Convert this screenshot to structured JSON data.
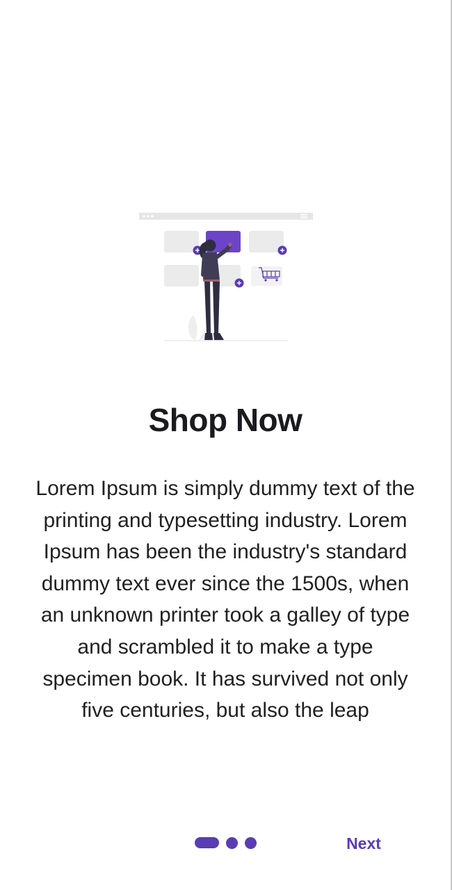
{
  "onboarding": {
    "illustration": "shopping-woman-illustration",
    "title": "Shop Now",
    "description": "Lorem Ipsum is simply dummy text of the printing and typesetting industry. Lorem Ipsum has been the industry's standard dummy text ever since the 1500s, when an unknown printer took a galley of type and scrambled it to make a type specimen book. It has survived not only five centuries, but also the leap",
    "next_label": "Next",
    "page_indicator": {
      "total_pages": 3,
      "current_page": 1
    }
  },
  "colors": {
    "accent": "#5a3cb4",
    "title_text": "#1b1b1f",
    "body_text": "#212121",
    "placeholder_gray": "#e6e6e6"
  }
}
